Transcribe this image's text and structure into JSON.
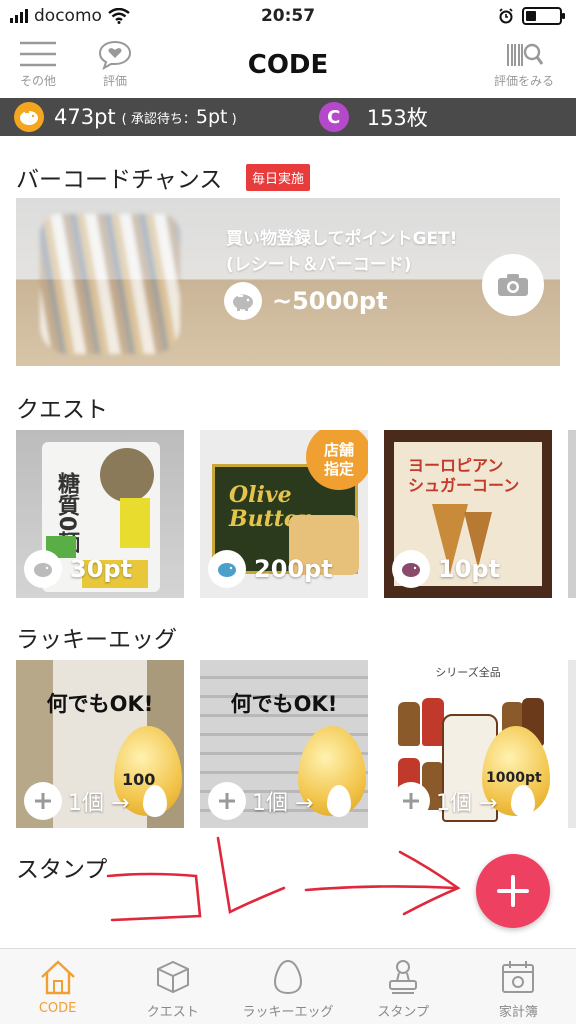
{
  "status_bar": {
    "carrier": "docomo",
    "time": "20:57",
    "battery_level": 0.3
  },
  "nav": {
    "left_label": "その他",
    "second_label": "評価",
    "title": "CODE",
    "right_label": "評価をみる"
  },
  "points_bar": {
    "points": "473pt",
    "pending_prefix": "( 承認待ち：",
    "pending_value": "5pt",
    "pending_suffix": " )",
    "coin_letter": "C",
    "coin_count": "153枚"
  },
  "barcode": {
    "title": "バーコードチャンス",
    "badge": "毎日実施",
    "banner_line1": "買い物登録してポイントGET!",
    "banner_line2": "(レシート＆バーコード)",
    "banner_points": "~5000pt"
  },
  "quest": {
    "title": "クエスト",
    "cards": [
      {
        "points": "30pt",
        "product_text": "糖質0麺"
      },
      {
        "points": "200pt",
        "product_text": "Olive Butter",
        "store_badge": "店舗\n指定"
      },
      {
        "points": "10pt",
        "product_text": "ヨーロピアン\nシュガーコーン"
      }
    ]
  },
  "lucky_egg": {
    "title": "ラッキーエッグ",
    "cards": [
      {
        "headline": "何でもOK!",
        "egg_value": "100",
        "count": "1個 →"
      },
      {
        "headline": "何でもOK!",
        "egg_value": "",
        "count": "1個 →"
      },
      {
        "headline": "シリーズ全品",
        "egg_value": "1000pt",
        "count": "1個 →"
      }
    ]
  },
  "stamp": {
    "title": "スタンプ",
    "annotation": "コレ"
  },
  "tabs": [
    {
      "label": "CODE",
      "icon": "house-icon",
      "active": true
    },
    {
      "label": "クエスト",
      "icon": "cube-icon",
      "active": false
    },
    {
      "label": "ラッキーエッグ",
      "icon": "egg-icon",
      "active": false
    },
    {
      "label": "スタンプ",
      "icon": "stamp-icon",
      "active": false
    },
    {
      "label": "家計簿",
      "icon": "calendar-icon",
      "active": false
    }
  ],
  "colors": {
    "accent": "#f0a030",
    "fab": "#ee4060",
    "badge": "#e83c3c",
    "coin_purple": "#b44ac9",
    "bar": "#4a4a4a",
    "annotation": "#e0283c"
  }
}
